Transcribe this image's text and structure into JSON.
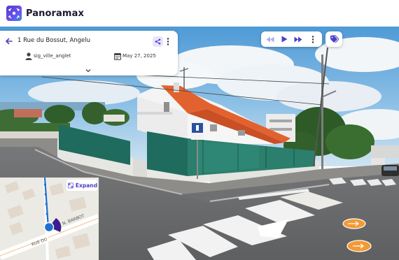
{
  "app": {
    "title": "Panoramax"
  },
  "picture": {
    "address": "1 Rue du Bossut, Angelu",
    "author": "sig_ville_anglet",
    "date": "May 27, 2025"
  },
  "minimap": {
    "expand_label": "Expand",
    "street_labels": [
      "N. BARBOT",
      "RUE DU"
    ]
  },
  "icons": {
    "logo": "panoramax-logo",
    "back": "arrow-left-icon",
    "share": "share-icon",
    "menu": "more-vertical-icon",
    "author": "user-icon",
    "date": "calendar-icon",
    "expand_card": "chevron-down-icon",
    "previous": "rewind-icon",
    "play": "play-icon",
    "next": "fast-forward-icon",
    "tags": "tag-icon",
    "expand_map": "expand-icon",
    "navigation": "arrow-icon"
  },
  "colors": {
    "accent": "#4b3fc6",
    "nav_arrow": "#f39a32",
    "map_sequence": "#1f6fd1"
  }
}
